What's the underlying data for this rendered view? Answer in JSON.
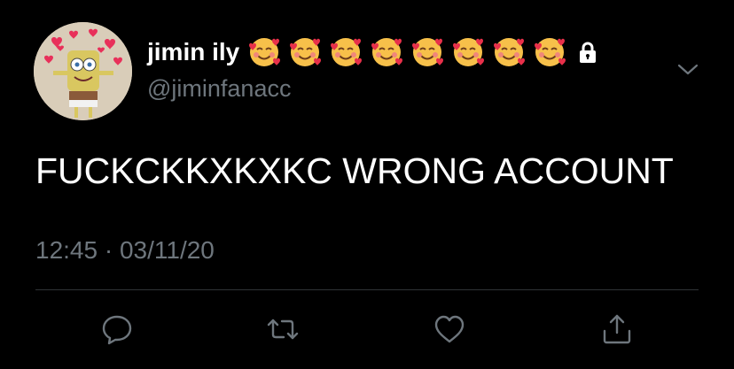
{
  "tweet": {
    "display_name": "jimin ily",
    "display_name_emojis": [
      "smiling-face-with-hearts",
      "smiling-face-with-hearts",
      "smiling-face-with-hearts",
      "smiling-face-with-hearts",
      "smiling-face-with-hearts",
      "smiling-face-with-hearts",
      "smiling-face-with-hearts",
      "smiling-face-with-hearts"
    ],
    "protected_icon": "lock-icon",
    "handle": "@jiminfanacc",
    "text": "FUCKCKKXKXKC WRONG ACCOUNT",
    "timestamp": "12:45 · 03/11/20"
  },
  "actions": {
    "reply_icon": "reply-icon",
    "retweet_icon": "retweet-icon",
    "like_icon": "heart-icon",
    "share_icon": "share-icon"
  },
  "colors": {
    "background": "#000000",
    "primary_text": "#ffffff",
    "secondary_text": "#6e767d",
    "divider": "#2f3336"
  }
}
